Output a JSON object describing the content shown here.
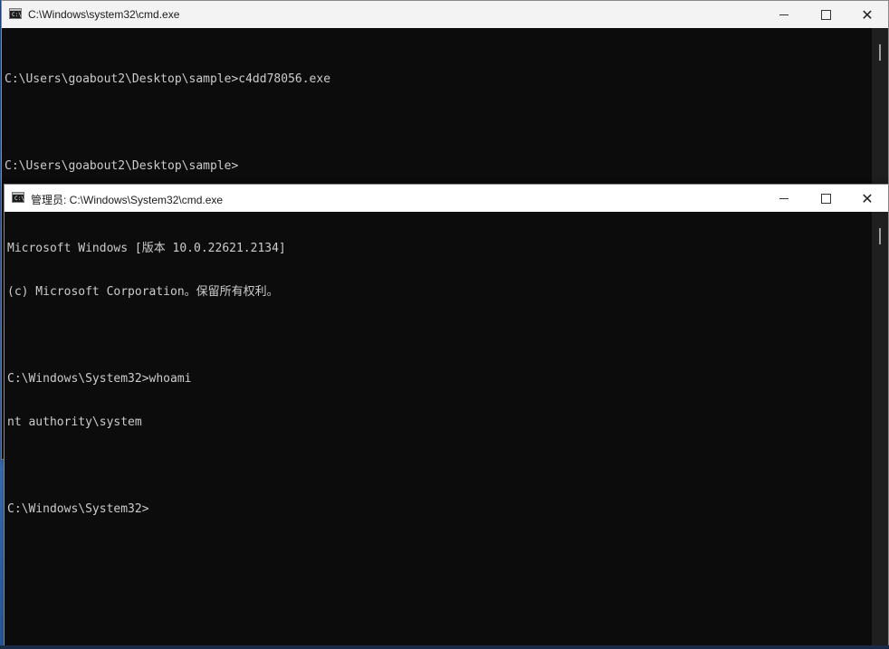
{
  "back_window": {
    "title": "C:\\Windows\\system32\\cmd.exe",
    "icon": "cmd-console-icon",
    "lines": [
      "C:\\Users\\goabout2\\Desktop\\sample>c4dd78056.exe",
      "",
      "C:\\Users\\goabout2\\Desktop\\sample>"
    ]
  },
  "front_window": {
    "title": "管理员: C:\\Windows\\System32\\cmd.exe",
    "icon": "cmd-console-icon",
    "lines": [
      "Microsoft Windows [版本 10.0.22621.2134]",
      "(c) Microsoft Corporation。保留所有权利。",
      "",
      "C:\\Windows\\System32>whoami",
      "nt authority\\system",
      "",
      "C:\\Windows\\System32>"
    ]
  },
  "window_controls": {
    "minimize": "minimize-icon",
    "maximize": "maximize-icon",
    "close": "close-icon"
  },
  "colors": {
    "console_bg": "#0c0c0c",
    "console_text": "#cccccc",
    "titlebar_bg": "#ffffff"
  }
}
